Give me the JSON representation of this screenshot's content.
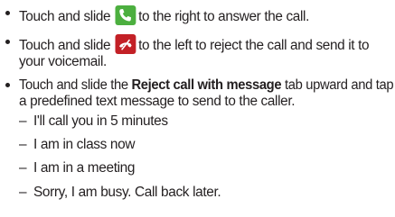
{
  "bullets": [
    {
      "before": "Touch and slide",
      "icon": "phone-answer-icon",
      "after": "to the right to answer the call."
    },
    {
      "before": "Touch and slide",
      "icon": "phone-reject-icon",
      "after_line1": "to the left to reject the call and send it to",
      "line2": "your voicemail."
    },
    {
      "before": "Touch and slide the ",
      "bold": "Reject call with message",
      "after_line1": " tab upward and tap",
      "line2": "a predefined text message to send to the caller."
    }
  ],
  "sub_items": [
    "I'll call you in 5 minutes",
    "I am in class now",
    "I am in a meeting",
    "Sorry, I am busy. Call back later."
  ],
  "dash": "–",
  "colors": {
    "text": "#231f20",
    "answer_icon": "#4caf3f",
    "reject_icon": "#c32026"
  }
}
